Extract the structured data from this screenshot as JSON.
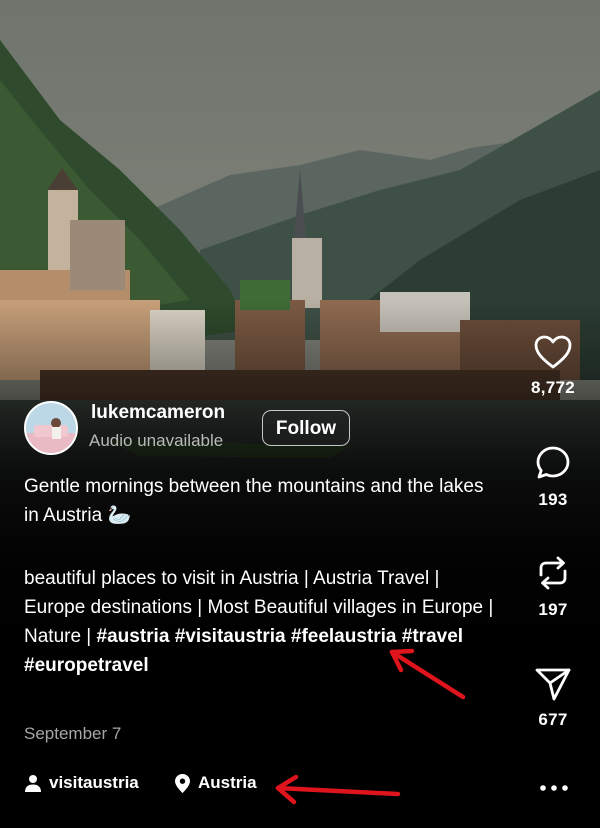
{
  "post": {
    "username": "lukemcameron",
    "audio_status": "Audio unavailable",
    "follow_label": "Follow",
    "caption_line1": "Gentle mornings between the mountains and the lakes in Austria",
    "caption_emoji": "🦢",
    "caption_body": "beautiful places to visit in Austria | Austria Travel | Europe destinations | Most Beautiful villages in Europe | Nature | ",
    "hashtags": [
      "#austria",
      "#visitaustria",
      "#feelaustria",
      "#travel",
      "#europetravel"
    ],
    "date": "September 7",
    "tagged_user": "visitaustria",
    "location": "Austria"
  },
  "actions": {
    "likes": "8,772",
    "comments": "193",
    "reposts": "197",
    "shares": "677"
  },
  "icons": {
    "like": "heart-icon",
    "comment": "comment-bubble-icon",
    "repost": "repost-icon",
    "share": "send-icon",
    "more": "more-dots-icon",
    "user": "person-icon",
    "location": "location-pin-icon"
  },
  "colors": {
    "annotation_arrow": "#e0141c",
    "muted_text": "#b9b9b9",
    "date_text": "#a6a6a6"
  }
}
